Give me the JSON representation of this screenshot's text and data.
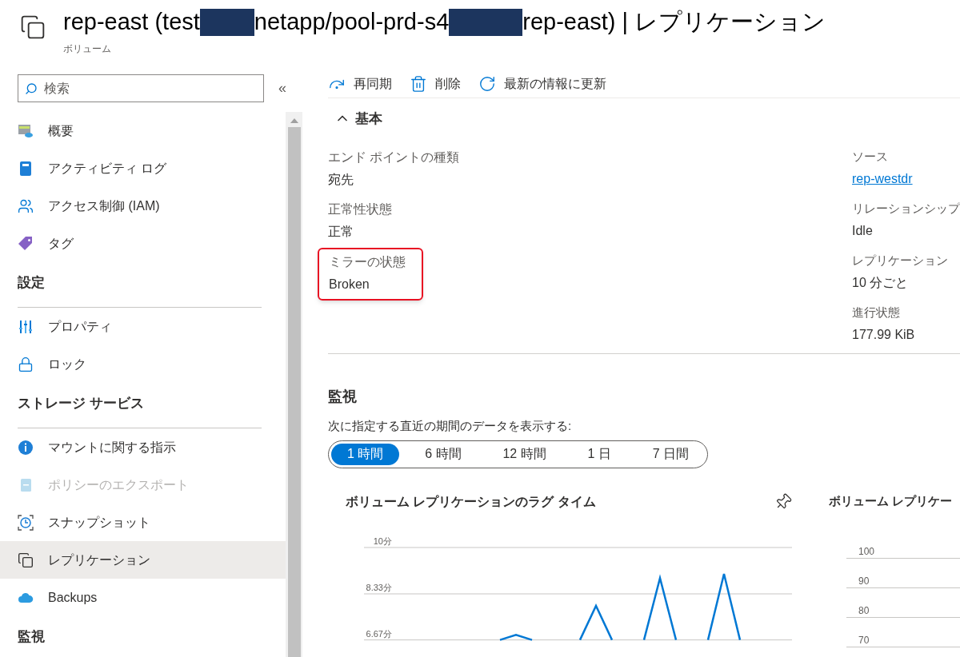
{
  "header": {
    "title_parts": [
      {
        "kind": "text",
        "text": "rep-east (test"
      },
      {
        "kind": "redacted"
      },
      {
        "kind": "text",
        "text": "netapp/pool-prd-s4"
      },
      {
        "kind": "redacted"
      },
      {
        "kind": "text",
        "text": "rep-east) | レプリケーション"
      }
    ],
    "subtitle": "ボリューム"
  },
  "sidebar": {
    "search": {
      "placeholder": "検索"
    },
    "collapse": "«",
    "groups": [
      {
        "items": [
          {
            "label": "概要",
            "selected": false,
            "disabled": false
          },
          {
            "label": "アクティビティ ログ",
            "selected": false,
            "disabled": false
          },
          {
            "label": "アクセス制御 (IAM)",
            "selected": false,
            "disabled": false
          },
          {
            "label": "タグ",
            "selected": false,
            "disabled": false
          }
        ]
      },
      {
        "heading": "設定",
        "items": [
          {
            "label": "プロパティ",
            "selected": false,
            "disabled": false
          },
          {
            "label": "ロック",
            "selected": false,
            "disabled": false
          }
        ]
      },
      {
        "heading": "ストレージ サービス",
        "items": [
          {
            "label": "マウントに関する指示",
            "selected": false,
            "disabled": false
          },
          {
            "label": "ポリシーのエクスポート",
            "selected": false,
            "disabled": true
          },
          {
            "label": "スナップショット",
            "selected": false,
            "disabled": false
          },
          {
            "label": "レプリケーション",
            "selected": true,
            "disabled": false
          },
          {
            "label": "Backups",
            "selected": false,
            "disabled": false
          }
        ]
      },
      {
        "heading": "監視"
      }
    ]
  },
  "toolbar": [
    {
      "label": "再同期"
    },
    {
      "label": "削除"
    },
    {
      "label": "最新の情報に更新"
    }
  ],
  "essentials": {
    "heading": "基本",
    "expanded": true,
    "left": [
      {
        "label": "エンド ポイントの種類",
        "value": "宛先",
        "kind": "text",
        "highlighted": false
      },
      {
        "label": "正常性状態",
        "value": "正常",
        "kind": "text",
        "highlighted": false
      },
      {
        "label": "ミラーの状態",
        "value": "Broken",
        "kind": "text",
        "highlighted": true
      }
    ],
    "right": [
      {
        "label": "ソース",
        "value": "rep-westdr",
        "kind": "link",
        "highlighted": false
      },
      {
        "label": "リレーションシップ",
        "value": "Idle",
        "kind": "text",
        "highlighted": false
      },
      {
        "label": "レプリケーション",
        "value": "10 分ごと",
        "kind": "text",
        "highlighted": false
      },
      {
        "label": "進行状態",
        "value": "177.99 KiB",
        "kind": "text",
        "highlighted": false
      }
    ]
  },
  "monitoring": {
    "heading": "監視",
    "caption": "次に指定する直近の期間のデータを表示する:",
    "ranges": [
      {
        "label": "1 時間",
        "selected": true
      },
      {
        "label": "6 時間",
        "selected": false
      },
      {
        "label": "12 時間",
        "selected": false
      },
      {
        "label": "1 日",
        "selected": false
      },
      {
        "label": "7 日間",
        "selected": false
      }
    ],
    "charts": [
      {
        "pinnable": true,
        "chart_data": {
          "type": "line",
          "title": "ボリューム レプリケーションのラグ タイム",
          "ylim": [
            6.67,
            10
          ],
          "yticks": [
            {
              "value": 10,
              "label": "10分"
            },
            {
              "value": 8.33,
              "label": "8.33分"
            },
            {
              "value": 6.67,
              "label": "6.67分"
            }
          ],
          "categories": [
            null,
            null,
            null,
            null,
            null,
            null,
            null,
            null,
            null,
            null,
            null,
            null,
            null,
            null,
            null,
            null,
            null,
            null,
            null,
            null,
            null,
            null,
            null,
            null,
            null,
            null,
            null
          ],
          "series": [
            {
              "color": "#0078d4",
              "values": [
                null,
                null,
                null,
                null,
                null,
                null,
                null,
                null,
                6.67,
                6.85,
                6.67,
                null,
                null,
                6.67,
                7.9,
                6.67,
                null,
                6.67,
                8.9,
                6.67,
                null,
                6.67,
                9.05,
                6.67,
                null,
                null,
                null
              ]
            }
          ]
        }
      },
      {
        "pinnable": false,
        "title": "ボリューム レプリケー",
        "gridline_labels": [
          "100",
          "90",
          "80",
          "70"
        ]
      }
    ]
  }
}
